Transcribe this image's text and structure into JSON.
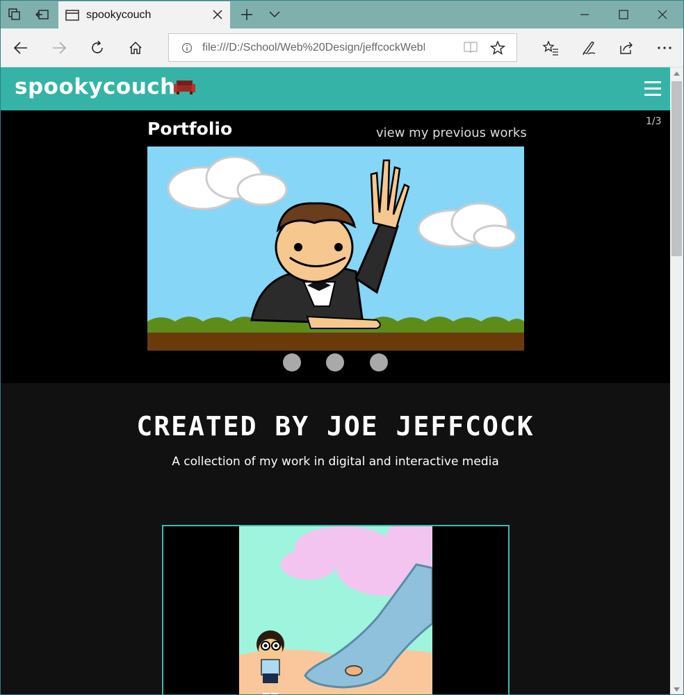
{
  "browser": {
    "tab_title": "spookycouch",
    "url": "file:///D:/School/Web%20Design/jeffcockWebProje",
    "icons": [
      "tab-manager-icon",
      "set-aside-tabs-icon",
      "page-icon",
      "close-icon",
      "new-tab-icon",
      "chevron-down-icon",
      "minimize-icon",
      "maximize-icon",
      "back-icon",
      "forward-icon",
      "refresh-icon",
      "home-icon",
      "info-icon",
      "reading-view-icon",
      "star-icon",
      "favorites-icon",
      "pen-icon",
      "share-icon",
      "more-icon"
    ]
  },
  "site": {
    "brand": "spookycouch",
    "accent": "#35b3a7",
    "carousel": {
      "counter": "1/3",
      "title": "Portfolio",
      "subtitle": "view my previous works",
      "active_slide": 1,
      "slide_count": 3
    },
    "intro": {
      "title": "CREATED BY JOE JEFFCOCK",
      "subtitle": "A collection of my work in digital and interactive media"
    }
  }
}
